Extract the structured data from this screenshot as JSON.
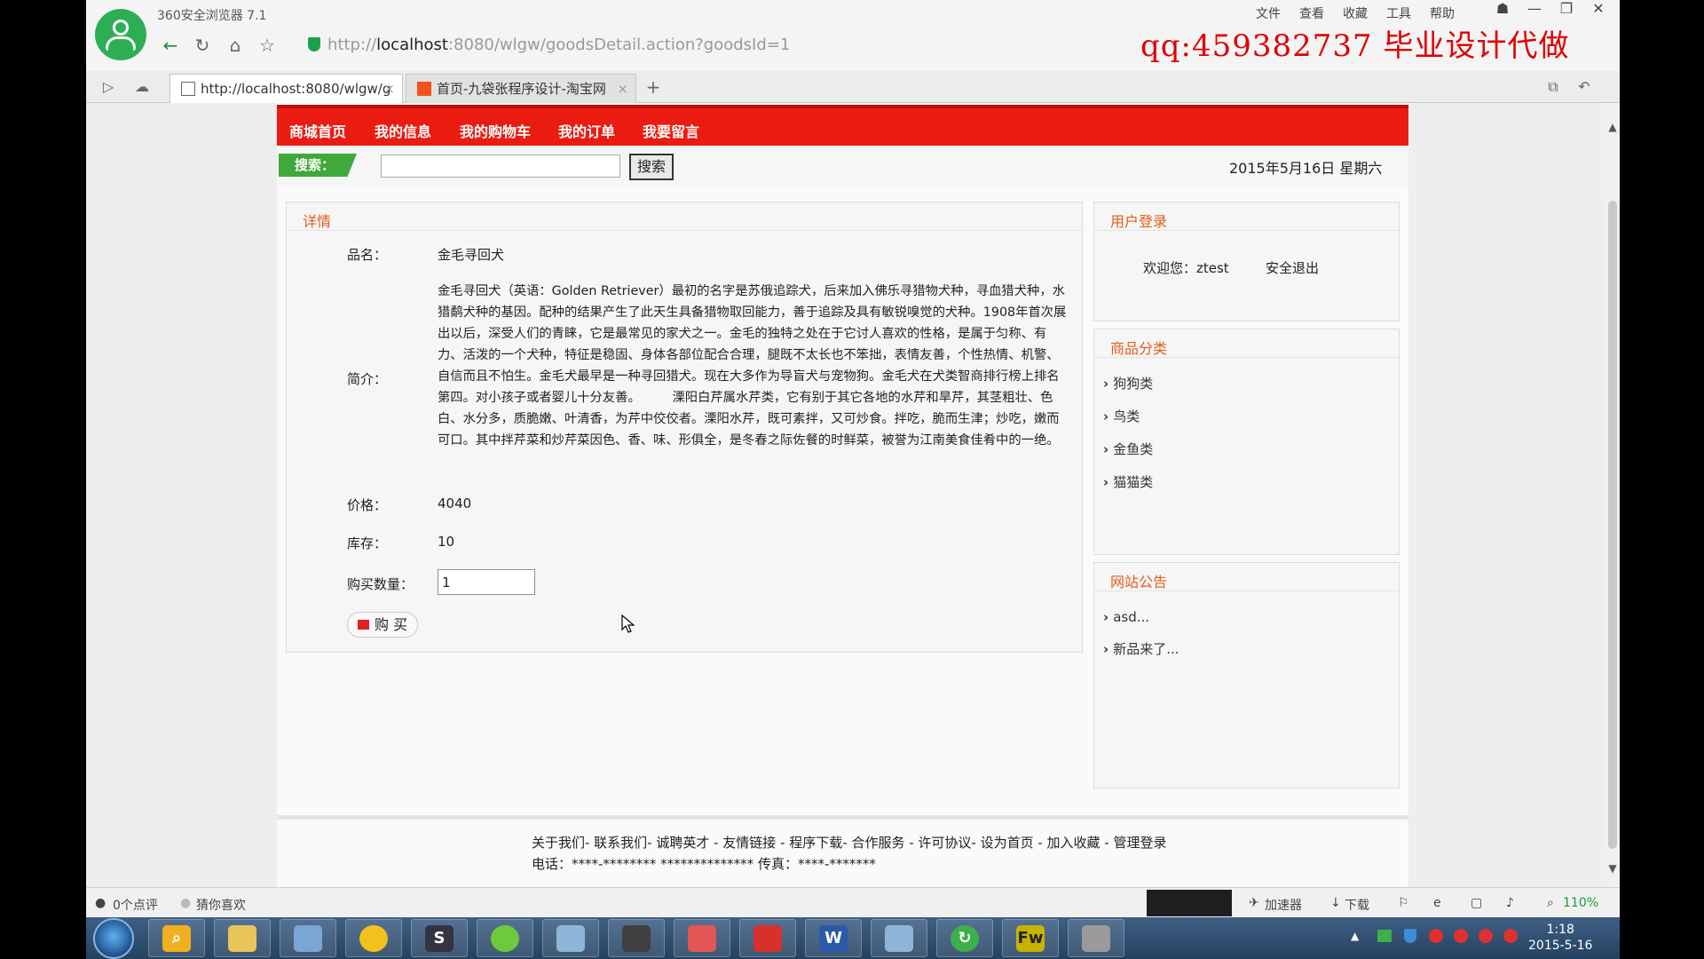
{
  "browser": {
    "app_title": "360安全浏览器 7.1",
    "menu": [
      "文件",
      "查看",
      "收藏",
      "工具",
      "帮助"
    ],
    "address_prefix": "http://",
    "address_host": "localhost",
    "address_rest": ":8080/wlgw/goodsDetail.action?goodsId=1",
    "watermark": "qq:459382737 毕业设计代做",
    "tabs": [
      {
        "label": "http://localhost:8080/wlgw/g"
      },
      {
        "label": "首页-九袋张程序设计-淘宝网"
      }
    ]
  },
  "site": {
    "menu": [
      "商城首页",
      "我的信息",
      "我的购物车",
      "我的订单",
      "我要留言"
    ],
    "search_label": "搜索：",
    "search_button": "搜索",
    "date": "2015年5月16日 星期六"
  },
  "detail": {
    "title": "详情",
    "name_label": "品名：",
    "name": "金毛寻回犬",
    "intro_label": "简介：",
    "intro": "金毛寻回犬（英语：Golden Retriever）最初的名字是苏俄追踪犬，后来加入佛乐寻猎物犬种，寻血猎犬种，水猎鹬犬种的基因。配种的结果产生了此天生具备猎物取回能力，善于追踪及具有敏锐嗅觉的犬种。1908年首次展出以后，深受人们的青睐，它是最常见的家犬之一。金毛的独特之处在于它讨人喜欢的性格，是属于匀称、有力、活泼的一个犬种，特征是稳固、身体各部位配合合理，腿既不太长也不笨拙，表情友善，个性热情、机警、自信而且不怕生。金毛犬最早是一种寻回猎犬。现在大多作为导盲犬与宠物狗。金毛犬在犬类智商排行榜上排名第四。对小孩子或者婴儿十分友善。　　　溧阳白芹属水芹类，它有别于其它各地的水芹和旱芹，其茎粗壮、色白、水分多，质脆嫩、叶清香，为芹中佼佼者。溧阳水芹，既可素拌，又可炒食。拌吃，脆而生津；炒吃，嫩而可口。其中拌芹菜和炒芹菜因色、香、味、形俱全，是冬春之际佐餐的时鲜菜，被誉为江南美食佳肴中的一绝。",
    "price_label": "价格：",
    "price": "4040",
    "stock_label": "库存：",
    "stock": "10",
    "qty_label": "购买数量：",
    "qty": "1",
    "buy_button": "购 买"
  },
  "sidebar": {
    "login_title": "用户登录",
    "welcome": "欢迎您：ztest",
    "logout": "安全退出",
    "category_title": "商品分类",
    "categories": [
      "狗狗类",
      "鸟类",
      "金鱼类",
      "猫猫类"
    ],
    "notice_title": "网站公告",
    "notices": [
      "asd...",
      "新品来了..."
    ]
  },
  "footer": {
    "links": "关于我们- 联系我们- 诚聘英才 - 友情链接 - 程序下载- 合作服务 - 许可协议- 设为首页 - 加入收藏 - 管理登录",
    "contact": "电话：****-******** ************** 传真：****-*******"
  },
  "statusbar": {
    "comments": "0个点评",
    "guess": "猜你喜欢",
    "accelerator": "加速器",
    "download": "下载",
    "zoom": "110%"
  },
  "taskbar": {
    "time": "1:18",
    "date": "2015-5-16"
  },
  "colors": {
    "menu_red": "#ea1c12",
    "accent_orange": "#e55c1a",
    "search_green": "#41a83c",
    "watermark_red": "#e00000"
  }
}
